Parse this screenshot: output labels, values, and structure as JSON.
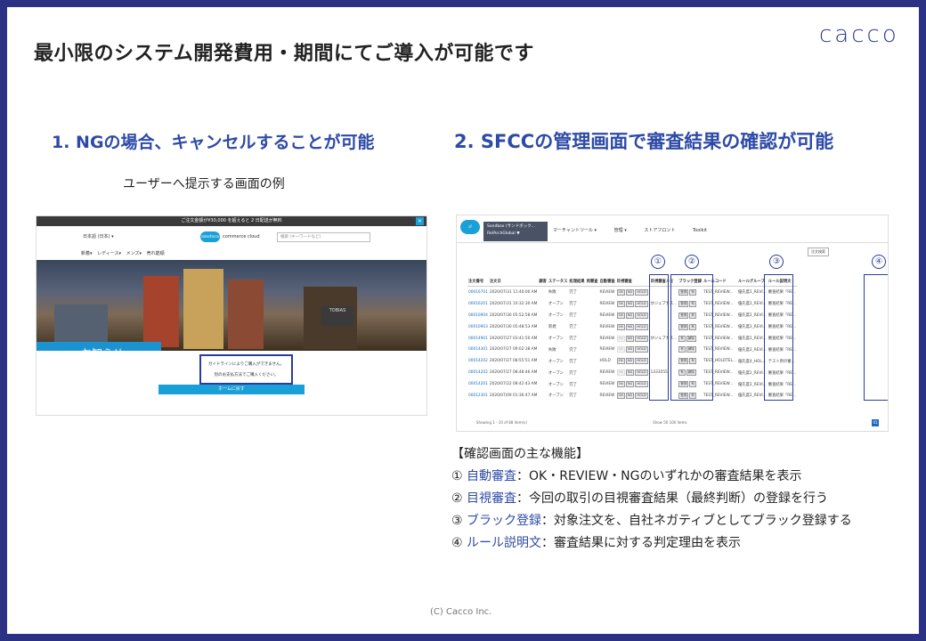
{
  "slide": {
    "title": "最小限のシステム開発費用・期間にてご導入が可能です",
    "logo": "cacco",
    "section1_title": "1. NGの場合、キャンセルすることが可能",
    "section2_title": "2. SFCCの管理画面で審査結果の確認が可能",
    "caption": "ユーザーへ提示する画面の例",
    "footer": "(C) Cacco Inc."
  },
  "storefront": {
    "promo_text": "ご注文金額が¥30,000 を超えると 2 日配送が無料",
    "close_glyph": "×",
    "lang": "日本語 (日本) ▾",
    "brand_name": "commerce cloud",
    "brand_cloud": "salesforce",
    "search_placeholder": "検索 (キーワードなど)",
    "nav_items": "新着▾   レディース▾   メンズ▾   売れ筋順",
    "hero_sign": "TOBIAS",
    "notice": "お知らせ",
    "message_line1": "ガイドラインによりご購入ができません。",
    "message_line2": "別のお支払方法でご購入ください。",
    "home_button": "ホームに戻す"
  },
  "admin": {
    "sandbox_line1": "Sandbox (サンドボック...",
    "sandbox_line2": "RefArchGlobal ▼",
    "menu": [
      "マーチャントツール ▾",
      "管理 ▾",
      "ストアフロント",
      "Toolkit"
    ],
    "order_search_button": "注文検索",
    "headers": [
      "注文番号",
      "注文日",
      "顧客",
      "ステータス",
      "処理結果",
      "再審査",
      "自動審査",
      "目視審査",
      "目視審査メモ",
      "ブラック登録",
      "ルールコード",
      "ルールグループ",
      "ルール説明文"
    ],
    "rows": [
      [
        "00016701",
        "2020/07/31 11:40:00 AM",
        "",
        "失敗",
        "完了",
        "",
        "REVIEW",
        "OK NG HOLD",
        "",
        "登録 有",
        "TEST_REVIEW...",
        "優先度2_REVI...",
        "審査結果「RE..."
      ],
      [
        "00016201",
        "2020/07/31 10:32:30 AM",
        "",
        "オープン",
        "完了",
        "",
        "REVIEW",
        "OK NG HOLD",
        "ｶｾジュプナス...",
        "登録 有",
        "TEST_REVIEW...",
        "優先度2_REVI...",
        "審査結果「RE..."
      ],
      [
        "00010904",
        "2020/07/30 05:52:58 AM",
        "",
        "オープン",
        "完了",
        "",
        "REVIEW",
        "OK NG HOLD",
        "",
        "登録 有",
        "TEST_REVIEW...",
        "優先度2_REVI...",
        "審査結果「RE..."
      ],
      [
        "00010903",
        "2020/07/30 05:48:53 AM",
        "",
        "新規",
        "完了",
        "",
        "REVIEW",
        "OK NG HOLD",
        "",
        "登録 有",
        "TEST_REVIEW...",
        "優先度2_REVI...",
        "審査結果「RE..."
      ],
      [
        "00014901",
        "2020/07/27 03:41:50 AM",
        "",
        "オープン",
        "完了",
        "",
        "REVIEW",
        "OK NG HOLD",
        "ｶｾジュプナス...",
        "有 解除",
        "TEST_REVIEW...",
        "優先度2_REVI...",
        "審査結果「RE..."
      ],
      [
        "00014301",
        "2020/07/27 09:02:38 AM",
        "",
        "失敗",
        "完了",
        "",
        "REVIEW",
        "OK NG HOLD",
        "",
        "有 解除",
        "TEST_REVIEW...",
        "優先度2_REVI...",
        "審査結果「RE..."
      ],
      [
        "00014202",
        "2020/07/27 08:55:51 AM",
        "",
        "オープン",
        "完了",
        "",
        "HOLD",
        "OK NG HOLD",
        "",
        "登録 有",
        "TEST_HOLDTEL...",
        "優先度4_HOL...",
        "テスト用の審..."
      ],
      [
        "00014202",
        "2020/07/27 08:48:46 AM",
        "",
        "オープン",
        "完了",
        "",
        "REVIEW",
        "OK NG HOLD",
        "1333555",
        "有 解除",
        "TEST_REVIEW...",
        "優先度2_REVI...",
        "審査結果「RE..."
      ],
      [
        "00014201",
        "2020/07/22 08:42:43 AM",
        "",
        "オープン",
        "完了",
        "",
        "REVIEW",
        "OK NG HOLD",
        "",
        "登録 有",
        "TEST_REVIEW...",
        "優先度2_REVI...",
        "審査結果「RE..."
      ],
      [
        "00012301",
        "2020/07/09 01:36:47 AM",
        "",
        "オープン",
        "完了",
        "",
        "REVIEW",
        "OK NG HOLD",
        "",
        "登録 有",
        "TEST_REVIEW...",
        "優先度2_REVI...",
        "審査結果「RE..."
      ]
    ],
    "markers": [
      "①",
      "②",
      "③",
      "④"
    ],
    "footer": "Showing 1 - 10 of 88 item(s)",
    "show_label": "Show 50 100 items",
    "page": "01"
  },
  "features": {
    "heading": "【確認画面の主な機能】",
    "items": [
      {
        "num": "①",
        "kw": "自動審査",
        "desc": "：OK・REVIEW・NGのいずれかの審査結果を表示"
      },
      {
        "num": "②",
        "kw": "目視審査",
        "desc": "：今回の取引の目視審査結果（最終判断）の登録を行う"
      },
      {
        "num": "③",
        "kw": "ブラック登録",
        "desc": "：対象注文を、自社ネガティブとしてブラック登録する"
      },
      {
        "num": "④",
        "kw": "ルール説明文",
        "desc": "：審査結果に対する判定理由を表示"
      }
    ]
  },
  "colors": {
    "frame": "#2b3183",
    "accent": "#2d4aa6",
    "link": "#1a6bc0",
    "sf_blue": "#1aa0d8"
  }
}
